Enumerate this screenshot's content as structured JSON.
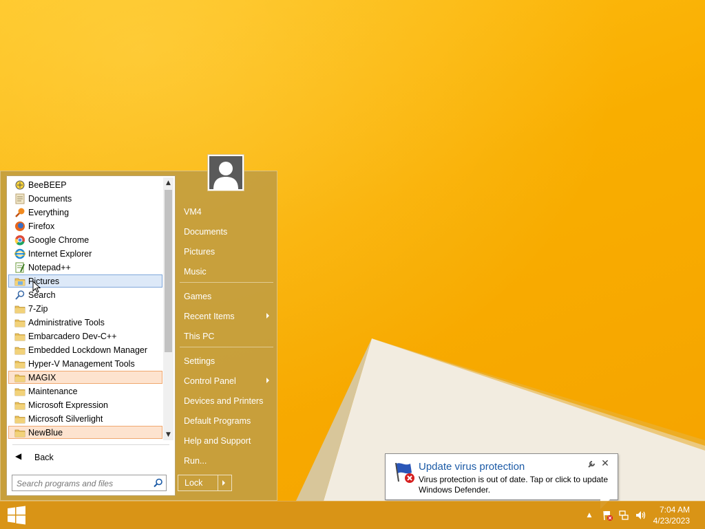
{
  "start_menu": {
    "programs": [
      {
        "label": "BeeBEEP",
        "icon": "beebeep-icon",
        "state": "normal"
      },
      {
        "label": "Documents",
        "icon": "documents-icon",
        "state": "normal"
      },
      {
        "label": "Everything",
        "icon": "everything-icon",
        "state": "normal"
      },
      {
        "label": "Firefox",
        "icon": "firefox-icon",
        "state": "normal"
      },
      {
        "label": "Google Chrome",
        "icon": "chrome-icon",
        "state": "normal"
      },
      {
        "label": "Internet Explorer",
        "icon": "internet-explorer-icon",
        "state": "normal"
      },
      {
        "label": "Notepad++",
        "icon": "notepad-plus-plus-icon",
        "state": "normal"
      },
      {
        "label": "Pictures",
        "icon": "pictures-folder-icon",
        "state": "selected"
      },
      {
        "label": "Search",
        "icon": "search-icon",
        "state": "normal"
      },
      {
        "label": "7-Zip",
        "icon": "folder-icon",
        "state": "normal"
      },
      {
        "label": "Administrative Tools",
        "icon": "folder-icon",
        "state": "normal"
      },
      {
        "label": "Embarcadero Dev-C++",
        "icon": "folder-icon",
        "state": "normal"
      },
      {
        "label": "Embedded Lockdown Manager",
        "icon": "folder-icon",
        "state": "normal"
      },
      {
        "label": "Hyper-V Management Tools",
        "icon": "folder-icon",
        "state": "normal"
      },
      {
        "label": "MAGIX",
        "icon": "folder-icon",
        "state": "highlight"
      },
      {
        "label": "Maintenance",
        "icon": "folder-icon",
        "state": "normal"
      },
      {
        "label": "Microsoft Expression",
        "icon": "folder-icon",
        "state": "normal"
      },
      {
        "label": "Microsoft Silverlight",
        "icon": "folder-icon",
        "state": "normal"
      },
      {
        "label": "NewBlue",
        "icon": "folder-icon",
        "state": "highlight"
      }
    ],
    "back_label": "Back",
    "search_placeholder": "Search programs and files",
    "right_items": [
      {
        "label": "VM4",
        "submenu": false
      },
      {
        "label": "Documents",
        "submenu": false
      },
      {
        "label": "Pictures",
        "submenu": false
      },
      {
        "label": "Music",
        "submenu": false
      },
      {
        "label": "Games",
        "submenu": false
      },
      {
        "label": "Recent Items",
        "submenu": true
      },
      {
        "label": "This PC",
        "submenu": false
      },
      {
        "label": "Settings",
        "submenu": false
      },
      {
        "label": "Control Panel",
        "submenu": true
      },
      {
        "label": "Devices and Printers",
        "submenu": false
      },
      {
        "label": "Default Programs",
        "submenu": false
      },
      {
        "label": "Help and Support",
        "submenu": false
      },
      {
        "label": "Run...",
        "submenu": false
      }
    ],
    "lock_label": "Lock"
  },
  "notification": {
    "title": "Update virus protection",
    "message": "Virus protection is out of date. Tap or click to update Windows Defender."
  },
  "taskbar": {
    "time": "7:04 AM",
    "date": "4/23/2023"
  },
  "colors": {
    "desktop": "#f9ae00",
    "taskbar": "#d69218",
    "start_menu": "#c49e40",
    "selected_item": "#dde9f8",
    "highlight_item": "#fde3cf",
    "balloon_title": "#1b5aa6"
  }
}
